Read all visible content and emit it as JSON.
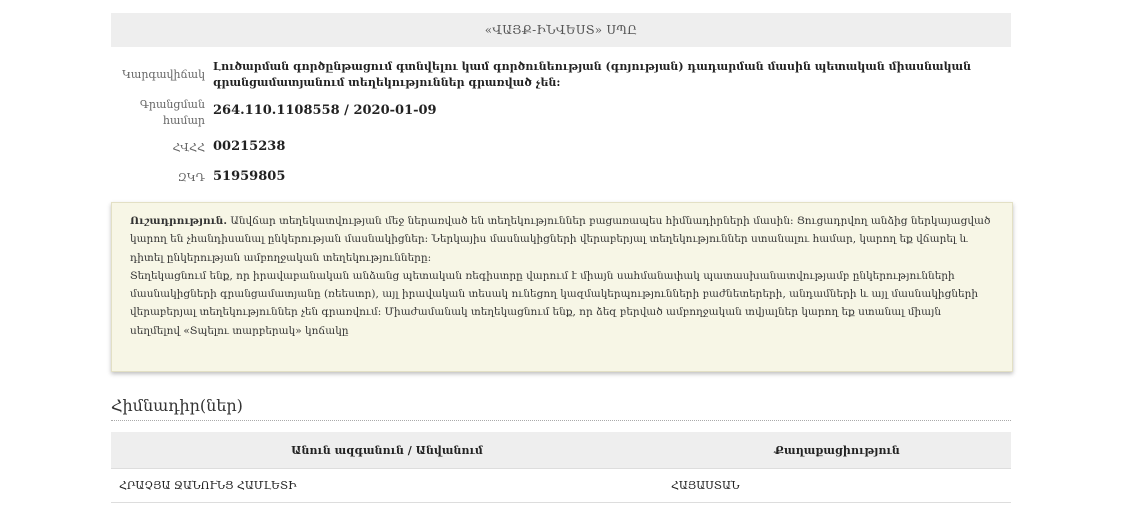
{
  "company": {
    "name": "«ՎԱՅՔ-ԻՆՎԵՍՏ» ՍՊԸ"
  },
  "details": {
    "status": {
      "label": "Կարգավիճակ",
      "value": "Լուծարման գործընթացում գտնվելու կամ գործունեության (գոյության) դադարման մասին պետական միասնական գրանցամատյանում տեղեկություններ գրառված չեն:"
    },
    "registration": {
      "label_line1": "Գրանցման",
      "label_line2": "համար",
      "value": "264.110.1108558 / 2020-01-09"
    },
    "tin": {
      "label": "ՀՎՀՀ",
      "value": "00215238"
    },
    "zkd": {
      "label": "ԶԿԴ",
      "value": "51959805"
    }
  },
  "notice": {
    "title": "Ուշադրություն.",
    "paragraph1": "Անվճար տեղեկատվության մեջ ներառված են տեղեկություններ բացառապես հիմնադիրների մասին: Ցուցադրվող անձից ներկայացված կարող են չհանդիսանալ ընկերության մասնակիցներ: Ներկայիս մասնակիցների վերաբերյալ տեղեկություններ ստանալու համար, կարող եք վճարել և դիտել ընկերության ամբողջական տեղեկությունները:",
    "paragraph2": "Տեղեկացնում ենք, որ իրավաբանական անձանց պետական ռեգիստրը վարում է միայն սահմանափակ պատասխանատվությամբ ընկերությունների մասնակիցների գրանցամատյանը (ռեեստր), այլ իրավական տեսակ ունեցող կազմակերպությունների բաժնետերերի, անդամների և այլ մասնակիցների վերաբերյալ տեղեկություններ չեն գրառվում: Միաժամանակ տեղեկացնում ենք, որ ձեզ բերված ամբողջական տվյալներ կարող եք ստանալ միայն սեղմելով «Տպելու տարբերակ» կոճակը"
  },
  "founders": {
    "heading": "Հիմնադիր(ներ)",
    "columns": [
      "Անուն ազգանուն / Անվանում",
      "Քաղաքացիություն"
    ],
    "rows": [
      [
        "ՀՐԱՉՅԱ ՋԱՆՈՒՆՑ ՀԱՄԼԵՏԻ",
        "ՀԱՅԱՍՏԱՆ"
      ]
    ]
  }
}
